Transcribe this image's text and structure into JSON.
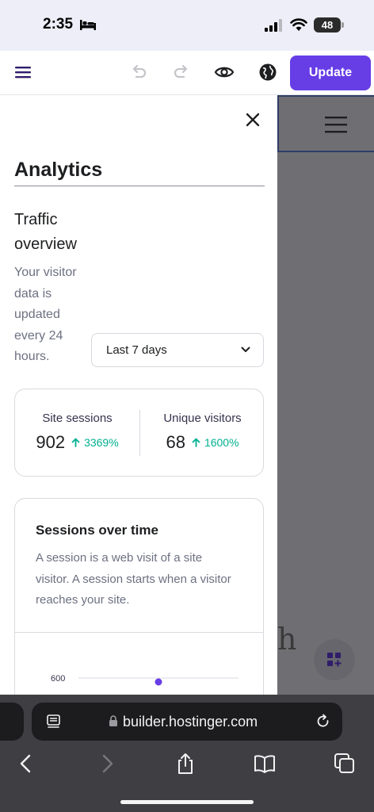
{
  "status_bar": {
    "time": "2:35",
    "battery": "48"
  },
  "toolbar": {
    "update_label": "Update"
  },
  "panel": {
    "title": "Analytics",
    "section_title": "Traffic overview",
    "section_description": "Your visitor data is updated every 24 hours.",
    "date_range": {
      "selected": "Last 7 days"
    }
  },
  "stats": [
    {
      "label": "Site sessions",
      "value": "902",
      "change": "3369%"
    },
    {
      "label": "Unique visitors",
      "value": "68",
      "change": "1600%"
    }
  ],
  "chart": {
    "title": "Sessions over time",
    "description": "A session is a web visit of a site visitor. A session starts when a visitor reaches your site."
  },
  "chart_data": {
    "type": "line",
    "title": "Sessions over time",
    "y_ticks": [
      600
    ],
    "visible_points": [
      {
        "y": 575
      }
    ],
    "colors": {
      "line": "#673de6"
    }
  },
  "preview": {
    "partial_glyph": "h"
  },
  "safari": {
    "url": "builder.hostinger.com"
  },
  "colors": {
    "accent": "#673de6",
    "positive": "#00b090"
  }
}
